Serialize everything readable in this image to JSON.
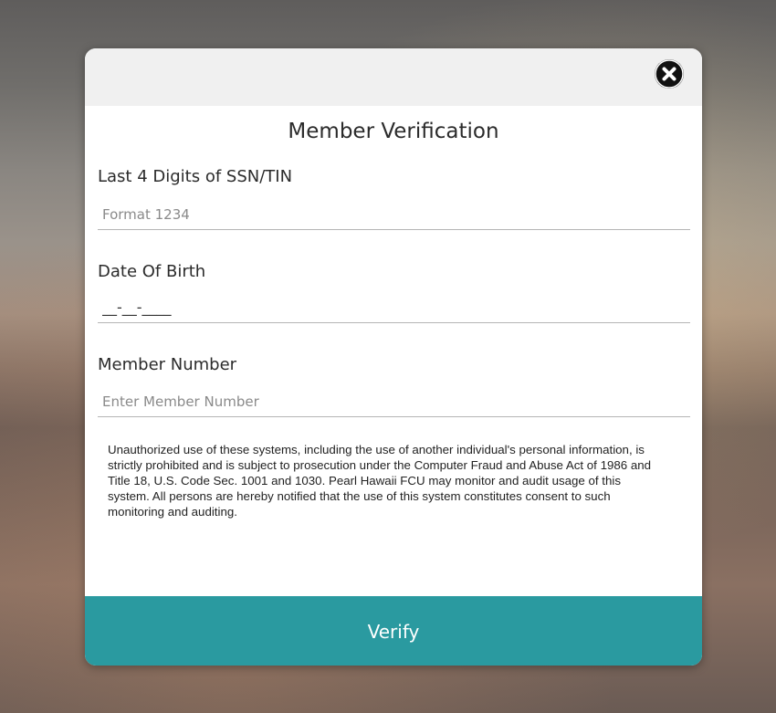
{
  "dialog": {
    "title": "Member Verification",
    "close_icon": "close-circle-icon"
  },
  "form": {
    "ssn": {
      "label": "Last 4 Digits of SSN/TIN",
      "placeholder": "Format 1234",
      "value": ""
    },
    "dob": {
      "label": "Date Of Birth",
      "placeholder": "__-__-____",
      "value": ""
    },
    "member_number": {
      "label": "Member Number",
      "placeholder": "Enter Member Number",
      "value": ""
    }
  },
  "disclaimer": "Unauthorized use of these systems, including the use of another individual's personal information, is strictly prohibited and is subject to prosecution under the Computer Fraud and Abuse Act of 1986 and Title 18, U.S. Code Sec. 1001 and 1030. Pearl Hawaii FCU may monitor and audit usage of this system. All persons are hereby notified that the use of this system constitutes consent to such monitoring and auditing.",
  "actions": {
    "verify_label": "Verify"
  },
  "colors": {
    "accent": "#2a9aa0",
    "header_bg": "#f0f0f0"
  }
}
